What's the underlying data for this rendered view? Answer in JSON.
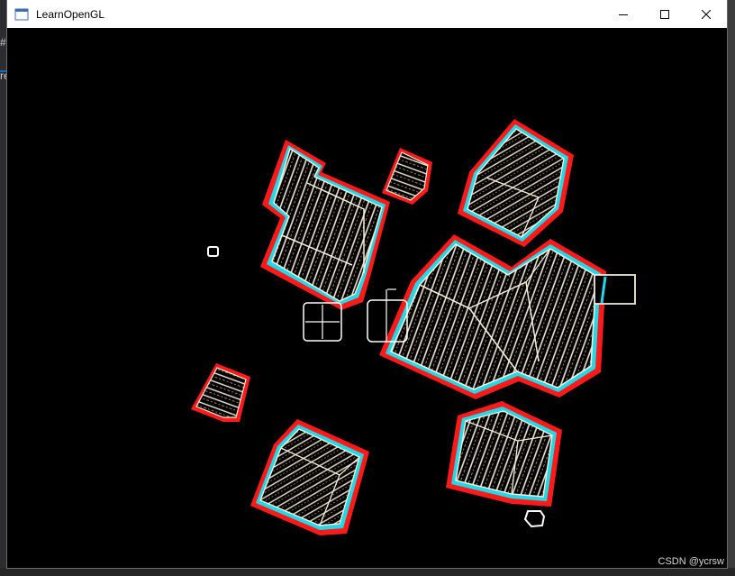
{
  "window": {
    "title": "LearnOpenGL",
    "icon": "app-window-icon",
    "controls": [
      "minimize",
      "maximize",
      "close"
    ]
  },
  "background": {
    "glyph_top": "#",
    "glyph_mid": "re"
  },
  "scene": {
    "background_color": "#000000",
    "outline_color": "#ff1a1a",
    "inner_outline_color": "#22d8e6",
    "edge_color": "#f5eedc",
    "wood_tint": "#c9a26a"
  },
  "watermark": "CSDN @ycrsw"
}
